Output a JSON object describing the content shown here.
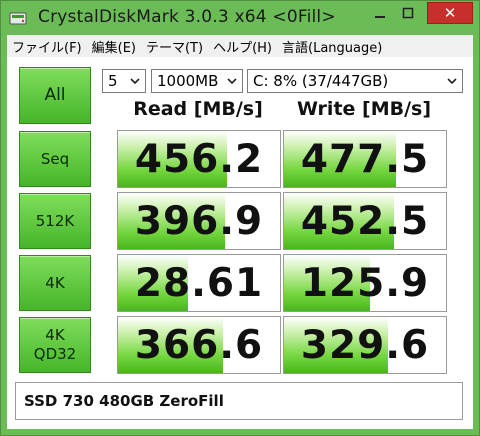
{
  "window": {
    "title": "CrystalDiskMark 3.0.3 x64 <0Fill>",
    "close_symbol": "✕"
  },
  "menu": [
    {
      "label": "ファイル(F)"
    },
    {
      "label": "編集(E)"
    },
    {
      "label": "テーマ(T)"
    },
    {
      "label": "ヘルプ(H)"
    },
    {
      "label": "言語(Language)"
    }
  ],
  "controls": {
    "all_label": "All",
    "count": "5",
    "size": "1000MB",
    "drive": "C: 8% (37/447GB)"
  },
  "headers": {
    "read": "Read [MB/s]",
    "write": "Write [MB/s]"
  },
  "rows": [
    {
      "label_line1": "Seq",
      "label_line2": "",
      "read": "456.2",
      "write": "477.5",
      "read_fill": 0.67,
      "write_fill": 0.69
    },
    {
      "label_line1": "512K",
      "label_line2": "",
      "read": "396.9",
      "write": "452.5",
      "read_fill": 0.66,
      "write_fill": 0.68
    },
    {
      "label_line1": "4K",
      "label_line2": "",
      "read": "28.61",
      "write": "125.9",
      "read_fill": 0.43,
      "write_fill": 0.53
    },
    {
      "label_line1": "4K",
      "label_line2": "QD32",
      "read": "366.6",
      "write": "329.6",
      "read_fill": 0.65,
      "write_fill": 0.64
    }
  ],
  "comment": "SSD 730 480GB ZeroFill",
  "colors": {
    "accent_green": "#46b52a",
    "close_red": "#c7302a"
  }
}
